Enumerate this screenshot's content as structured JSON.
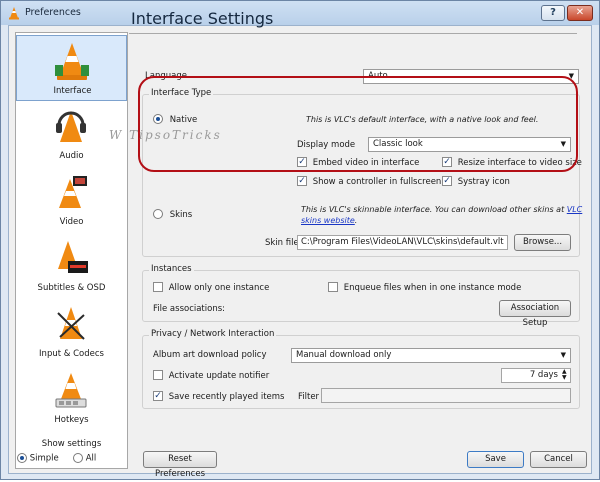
{
  "window": {
    "title": "Preferences",
    "help_glyph": "?",
    "close_glyph": "✕"
  },
  "sidebar": {
    "items": [
      {
        "label": "Interface"
      },
      {
        "label": "Audio"
      },
      {
        "label": "Video"
      },
      {
        "label": "Subtitles & OSD"
      },
      {
        "label": "Input & Codecs"
      },
      {
        "label": "Hotkeys"
      }
    ],
    "show_settings": "Show settings",
    "simple": "Simple",
    "all": "All"
  },
  "main": {
    "heading": "Interface Settings",
    "language_label": "Language",
    "language_value": "Auto",
    "interface_type_title": "Interface Type",
    "native_label": "Native",
    "native_desc": "This is VLC's default interface, with a native look and feel.",
    "display_mode_label": "Display mode",
    "display_mode_value": "Classic look",
    "embed_video": "Embed video in interface",
    "resize_interface": "Resize interface to video size",
    "show_controller": "Show a controller in fullscreen",
    "systray": "Systray icon",
    "skins_label": "Skins",
    "skins_desc": "This is VLC's skinnable interface. You can download other skins at",
    "skins_link_1": "VLC",
    "skins_link_2": "skins website",
    "skins_desc_end": ".",
    "skin_file_label": "Skin file",
    "skin_file_value": "C:\\Program Files\\VideoLAN\\VLC\\skins\\default.vlt",
    "browse": "Browse...",
    "instances_title": "Instances",
    "one_instance": "Allow only one instance",
    "enqueue": "Enqueue files when in one instance mode",
    "file_assoc_label": "File associations:",
    "assoc_setup": "Association Setup",
    "privacy_title": "Privacy / Network Interaction",
    "album_art_label": "Album art download policy",
    "album_art_value": "Manual download only",
    "update_notifier": "Activate update notifier",
    "update_days": "7 days",
    "save_recent": "Save recently played items",
    "filter_label": "Filter"
  },
  "footer": {
    "reset": "Reset Preferences",
    "save": "Save",
    "cancel": "Cancel"
  },
  "watermark": "W TipsoTricks",
  "colors": {
    "accent": "#b30f16",
    "cone_orange": "#f08a12"
  }
}
